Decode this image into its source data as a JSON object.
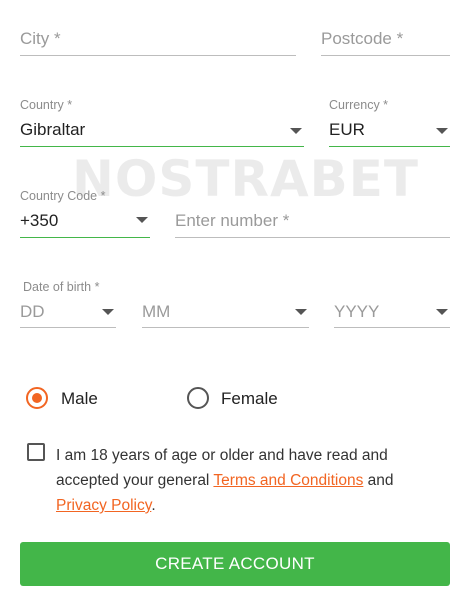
{
  "form": {
    "city": {
      "placeholder": "City *"
    },
    "postcode": {
      "placeholder": "Postcode *"
    },
    "country": {
      "label": "Country *",
      "value": "Gibraltar"
    },
    "currency": {
      "label": "Currency *",
      "value": "EUR"
    },
    "country_code": {
      "label": "Country Code *",
      "value": "+350"
    },
    "phone": {
      "placeholder": "Enter number *"
    },
    "dob": {
      "label": "Date of birth *",
      "day": "DD",
      "month": "MM",
      "year": "YYYY"
    },
    "gender": {
      "male": "Male",
      "female": "Female",
      "selected": "Male"
    },
    "terms": {
      "text_1": "I am 18 years of age or older and have read and accepted your general ",
      "terms_link": "Terms and Conditions",
      "text_2": " and ",
      "privacy_link": "Privacy Policy",
      "text_3": "."
    },
    "submit_label": "CREATE ACCOUNT"
  },
  "watermark": "NOSTRABET",
  "colors": {
    "accent_green": "#43b649",
    "accent_orange": "#f26522"
  }
}
